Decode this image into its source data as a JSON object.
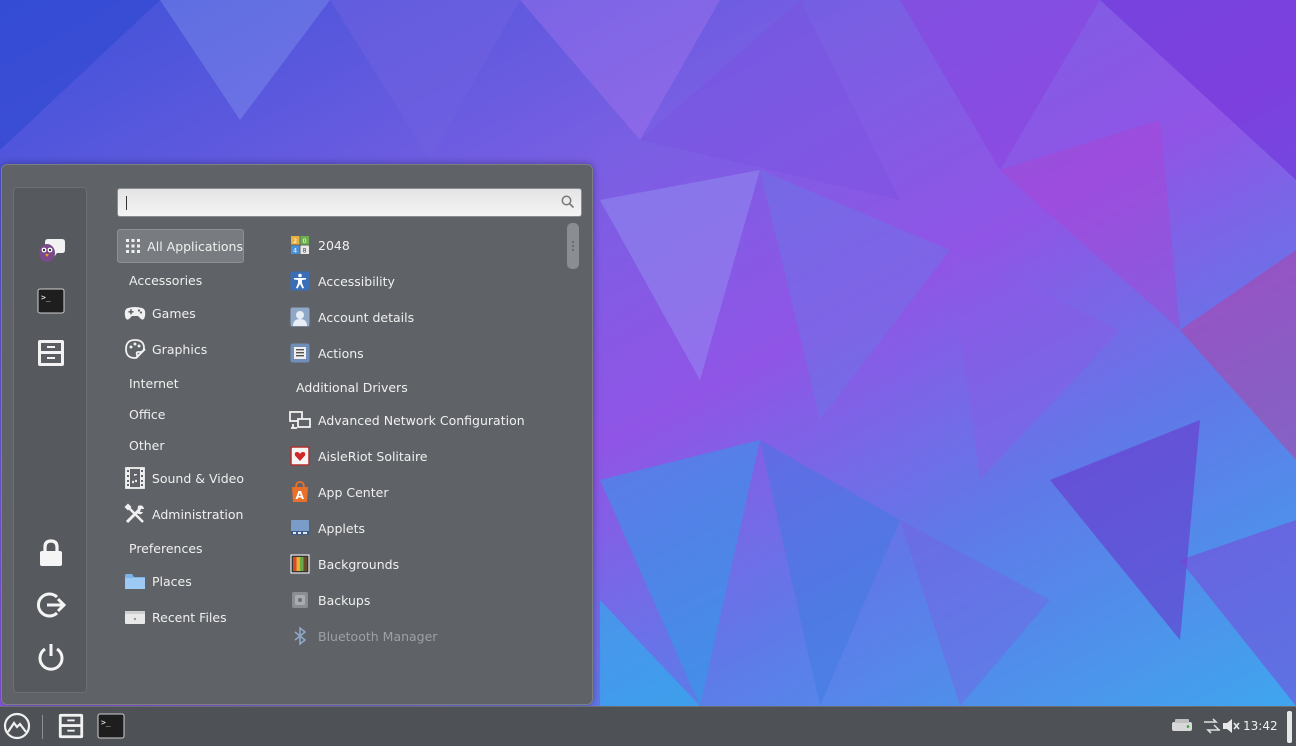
{
  "search": {
    "value": "",
    "placeholder": ""
  },
  "categories": [
    {
      "label": "All Applications",
      "icon": "grid-icon",
      "selected": true
    },
    {
      "label": "Accessories",
      "icon": ""
    },
    {
      "label": "Games",
      "icon": "gamepad-icon"
    },
    {
      "label": "Graphics",
      "icon": "palette-icon"
    },
    {
      "label": "Internet",
      "icon": ""
    },
    {
      "label": "Office",
      "icon": ""
    },
    {
      "label": "Other",
      "icon": ""
    },
    {
      "label": "Sound & Video",
      "icon": "film-icon"
    },
    {
      "label": "Administration",
      "icon": "tools-icon"
    },
    {
      "label": "Preferences",
      "icon": ""
    },
    {
      "label": "Places",
      "icon": "folder-icon"
    },
    {
      "label": "Recent Files",
      "icon": "recent-files-icon"
    }
  ],
  "apps": [
    {
      "label": "2048",
      "icon": "2048-icon"
    },
    {
      "label": "Accessibility",
      "icon": "accessibility-icon"
    },
    {
      "label": "Account details",
      "icon": "account-icon"
    },
    {
      "label": "Actions",
      "icon": "actions-icon"
    },
    {
      "label": "Additional Drivers",
      "icon": ""
    },
    {
      "label": "Advanced Network Configuration",
      "icon": "network-icon"
    },
    {
      "label": "AisleRiot Solitaire",
      "icon": "cards-icon"
    },
    {
      "label": "App Center",
      "icon": "app-center-icon"
    },
    {
      "label": "Applets",
      "icon": "applets-icon"
    },
    {
      "label": "Backgrounds",
      "icon": "backgrounds-icon"
    },
    {
      "label": "Backups",
      "icon": "backups-icon"
    },
    {
      "label": "Bluetooth Manager",
      "icon": "bluetooth-icon",
      "dim": true
    }
  ],
  "favorites": [
    {
      "icon": "pidgin-icon"
    },
    {
      "icon": "terminal-icon"
    },
    {
      "icon": "file-manager-icon"
    }
  ],
  "session": [
    {
      "icon": "lock-icon"
    },
    {
      "icon": "logout-icon"
    },
    {
      "icon": "power-icon"
    }
  ],
  "panel": {
    "clock": "13:42",
    "colors": {
      "panel": "#4e5155",
      "menu": "#5f6266"
    }
  }
}
